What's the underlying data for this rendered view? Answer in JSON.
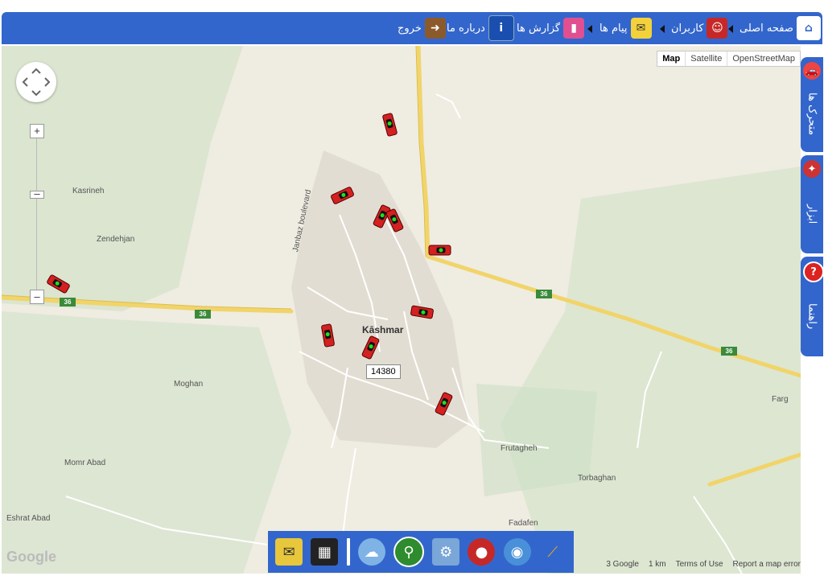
{
  "nav": {
    "home": "صفحه اصلی",
    "users": "کاربران",
    "messages": "پیام ها",
    "reports": "گزارش ها",
    "about": "درباره ما",
    "exit": "خروج"
  },
  "map": {
    "types": [
      "Map",
      "Satellite",
      "OpenStreetMap"
    ],
    "places": {
      "kasrineh": "Kasrineh",
      "zendehjan": "Zendehjan",
      "moghan": "Moghan",
      "momr_abad": "Momr Abad",
      "eshrat_abad": "Eshrat Abad",
      "kashmar": "Kāshmar",
      "frutagheh": "Frutagheh",
      "torbaghan": "Torbaghan",
      "fadafen": "Fadafen",
      "farg": "Farg",
      "janbaz": "Janbaz boulevard"
    },
    "highway": "36",
    "tooltip": "14380",
    "attribution": {
      "data": "3 Google",
      "scale": "1 km",
      "terms": "Terms of Use",
      "report": "Report a map error"
    },
    "logo": "Google"
  },
  "sidetabs": {
    "vehicles": "متحرک ها",
    "tools": "ابزار",
    "help": "راهنما"
  },
  "dock": {
    "icons": [
      "envelope-icon",
      "clapperboard-icon",
      "weather-icon",
      "bicycle-icon",
      "gear-tools-icon",
      "red-button-icon",
      "globe-icon",
      "broom-icon"
    ]
  }
}
